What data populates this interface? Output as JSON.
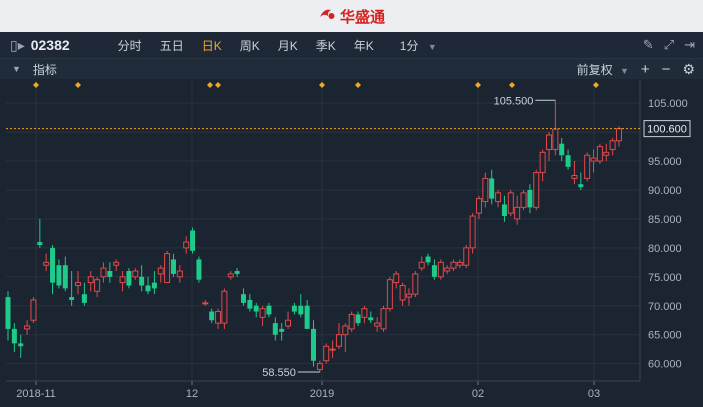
{
  "app": {
    "title": "华盛通"
  },
  "toolbar": {
    "stock_code": "02382",
    "tabs": [
      "分时",
      "五日",
      "日K",
      "周K",
      "月K",
      "季K",
      "年K"
    ],
    "active_tab": "日K",
    "interval": "1分"
  },
  "indicator_bar": {
    "label": "指标",
    "adjust": "前复权"
  },
  "colors": {
    "up": "#e04a4a",
    "down": "#1ecb8b",
    "current_price_line": "#f5a623",
    "marker": "#f5a623"
  },
  "chart_data": {
    "type": "candlestick",
    "y_ticks": [
      "105.000",
      "100.000",
      "95.000",
      "90.000",
      "85.000",
      "80.000",
      "75.000",
      "70.000",
      "65.000",
      "60.000"
    ],
    "ylim": [
      57.0,
      109.0
    ],
    "x_tick_labels": [
      "2018-11",
      "12",
      "2019",
      "02",
      "03"
    ],
    "current_price": "100.600",
    "high_annotation": "105.500",
    "low_annotation": "58.550",
    "candles": [
      [
        71.5,
        72.5,
        64,
        66
      ],
      [
        66,
        67,
        62,
        63.5
      ],
      [
        63.5,
        65,
        61,
        63
      ],
      [
        66,
        67.5,
        65,
        66.5
      ],
      [
        67.5,
        71.5,
        67,
        71
      ],
      [
        81,
        85,
        80,
        80.5
      ],
      [
        77,
        79,
        76,
        77.5
      ],
      [
        80,
        80.5,
        72,
        74
      ],
      [
        77,
        78,
        73,
        73.5
      ],
      [
        77,
        78.5,
        72.5,
        73
      ],
      [
        71.5,
        76,
        70,
        71
      ],
      [
        73.5,
        76,
        72,
        74
      ],
      [
        72,
        74,
        70,
        70.5
      ],
      [
        74,
        76,
        72.5,
        75
      ],
      [
        72.5,
        75,
        71.5,
        74.5
      ],
      [
        75,
        77.5,
        74,
        76.5
      ],
      [
        76,
        77.5,
        74,
        75
      ],
      [
        77,
        78,
        76,
        77.5
      ],
      [
        74,
        76,
        72.5,
        75
      ],
      [
        76,
        76.5,
        73,
        73.5
      ],
      [
        75,
        76.5,
        74.5,
        76
      ],
      [
        75,
        77,
        72.5,
        73.5
      ],
      [
        73.5,
        75,
        72,
        72.5
      ],
      [
        74,
        76,
        72,
        73
      ],
      [
        75.5,
        77,
        74,
        76.5
      ],
      [
        74,
        79.5,
        74,
        79
      ],
      [
        78,
        79,
        75,
        75.5
      ],
      [
        75,
        77,
        74,
        76
      ],
      [
        80,
        82,
        79,
        81
      ],
      [
        83,
        83.5,
        79,
        79.5
      ],
      [
        78,
        78.5,
        74,
        74.5
      ],
      [
        70.5,
        71,
        70,
        70.5
      ],
      [
        69,
        69.5,
        67,
        67.5
      ],
      [
        67,
        69.5,
        66,
        69
      ],
      [
        67,
        73,
        66,
        72.5
      ],
      [
        75,
        76,
        74.5,
        75.5
      ],
      [
        76,
        76.5,
        75,
        75.5
      ],
      [
        72,
        73,
        70,
        70.5
      ],
      [
        71,
        72,
        69,
        69.5
      ],
      [
        70,
        70.5,
        68,
        69
      ],
      [
        68,
        70,
        66.5,
        69.5
      ],
      [
        70,
        70.5,
        68,
        68.5
      ],
      [
        67,
        68,
        64,
        65
      ],
      [
        66,
        67,
        64,
        65.5
      ],
      [
        66.5,
        69,
        66,
        67.5
      ],
      [
        70,
        70.5,
        68.5,
        69
      ],
      [
        70,
        72,
        68,
        68.5
      ],
      [
        70,
        71,
        66,
        66
      ],
      [
        66,
        67.5,
        59.5,
        60.5
      ],
      [
        59,
        60.5,
        58.55,
        60
      ],
      [
        60.5,
        63.5,
        60,
        63
      ],
      [
        62.5,
        64,
        61,
        62.5
      ],
      [
        63,
        67,
        62.5,
        65
      ],
      [
        65,
        67,
        62,
        66.5
      ],
      [
        66,
        69,
        65.5,
        68.5
      ],
      [
        68.5,
        69,
        66.5,
        67
      ],
      [
        68,
        70,
        67,
        69.5
      ],
      [
        68,
        69,
        67,
        67.5
      ],
      [
        66.5,
        68,
        65.5,
        67
      ],
      [
        66,
        70,
        65.5,
        69.5
      ],
      [
        69.5,
        75,
        69,
        74.5
      ],
      [
        74,
        76,
        73,
        75.5
      ],
      [
        71,
        74,
        70,
        73.5
      ],
      [
        71.5,
        73,
        70,
        72
      ],
      [
        72,
        76,
        71.5,
        75.5
      ],
      [
        76.5,
        78.5,
        76,
        77.5
      ],
      [
        78.5,
        79,
        77,
        77.5
      ],
      [
        77,
        78,
        74.5,
        75
      ],
      [
        75,
        78,
        74.5,
        77.5
      ],
      [
        76,
        77,
        75.5,
        76.5
      ],
      [
        76.5,
        78,
        76,
        77.5
      ],
      [
        77,
        78,
        76.5,
        77.5
      ],
      [
        77,
        80.5,
        76.5,
        80
      ],
      [
        80,
        86,
        79,
        85.5
      ],
      [
        86,
        89,
        85,
        88.5
      ],
      [
        88,
        93,
        87,
        92
      ],
      [
        92,
        93.5,
        87.5,
        88.5
      ],
      [
        88,
        90,
        87,
        89.5
      ],
      [
        87.5,
        89,
        84.5,
        85.5
      ],
      [
        86,
        90,
        85.5,
        89.5
      ],
      [
        85,
        89,
        84,
        87
      ],
      [
        87,
        90,
        86.5,
        89.5
      ],
      [
        90,
        91,
        86,
        87
      ],
      [
        87,
        93.5,
        86.5,
        93
      ],
      [
        93,
        97,
        91.5,
        96.5
      ],
      [
        97,
        100,
        95,
        99.5
      ],
      [
        97,
        105.5,
        96,
        100.5
      ],
      [
        98,
        99,
        95,
        96
      ],
      [
        96,
        97,
        93.5,
        94
      ],
      [
        92,
        95,
        91,
        92.5
      ],
      [
        91,
        93,
        90,
        90.5
      ],
      [
        92,
        96.5,
        91.5,
        96
      ],
      [
        95,
        97,
        93,
        95.5
      ],
      [
        95,
        98,
        94.5,
        97.5
      ],
      [
        96,
        98,
        95,
        96.5
      ],
      [
        97,
        99,
        96,
        98.5
      ],
      [
        98.5,
        101,
        97.5,
        100.6
      ]
    ]
  }
}
